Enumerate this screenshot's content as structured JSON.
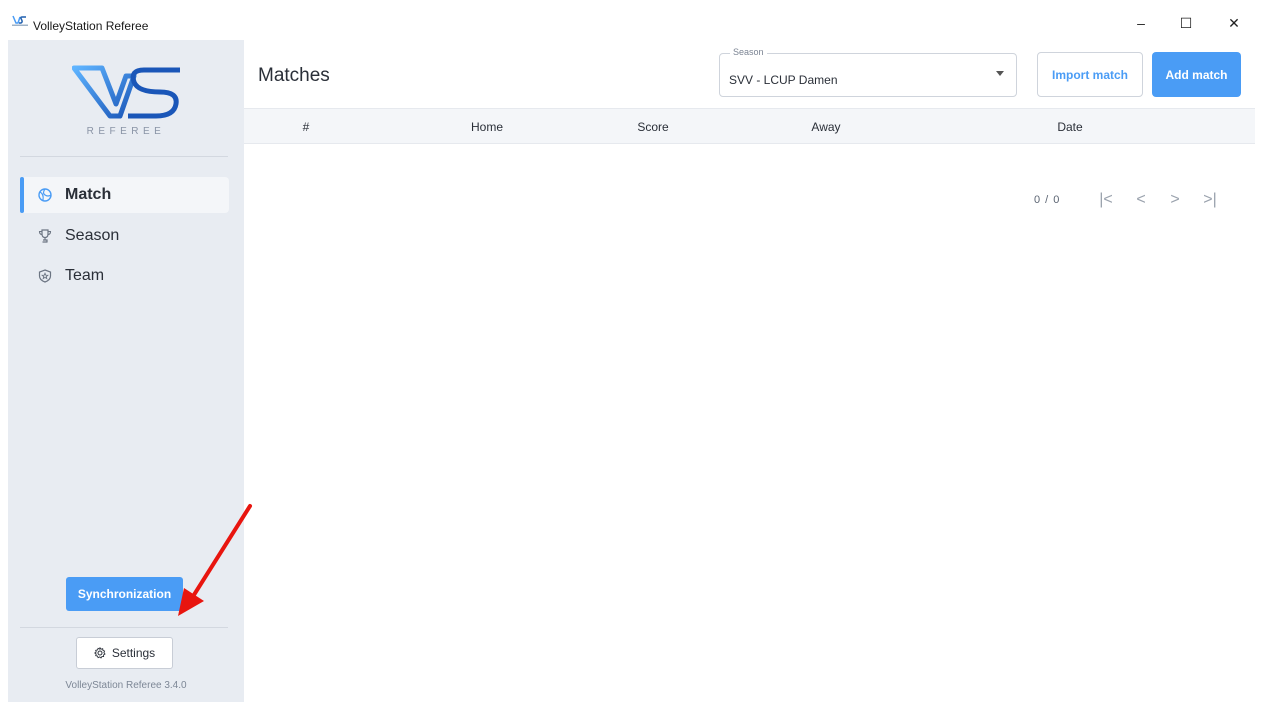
{
  "window": {
    "title": "VolleyStation Referee",
    "controls": {
      "minimize": "–",
      "maximize": "☐",
      "close": "✕"
    }
  },
  "sidebar": {
    "logo_text": "VS",
    "logo_subtitle": "REFEREE",
    "items": [
      {
        "label": "Match",
        "icon": "volleyball-icon",
        "active": true
      },
      {
        "label": "Season",
        "icon": "trophy-icon",
        "active": false
      },
      {
        "label": "Team",
        "icon": "shield-icon",
        "active": false
      }
    ],
    "sync_label": "Synchronization",
    "settings_label": "Settings",
    "version": "VolleyStation Referee 3.4.0"
  },
  "main": {
    "title": "Matches",
    "season": {
      "legend": "Season",
      "value": "SVV - LCUP Damen"
    },
    "import_label": "Import match",
    "add_label": "Add match",
    "table": {
      "columns": [
        "#",
        "Home",
        "Score",
        "Away",
        "Date"
      ],
      "rows": []
    },
    "pagination": {
      "count": "0 / 0",
      "first": "|<",
      "prev": "<",
      "next": ">",
      "last": ">|"
    }
  },
  "colors": {
    "accent": "#4a9cf5",
    "sidebar_bg": "#e8ecf2",
    "arrow": "#e8150f"
  }
}
